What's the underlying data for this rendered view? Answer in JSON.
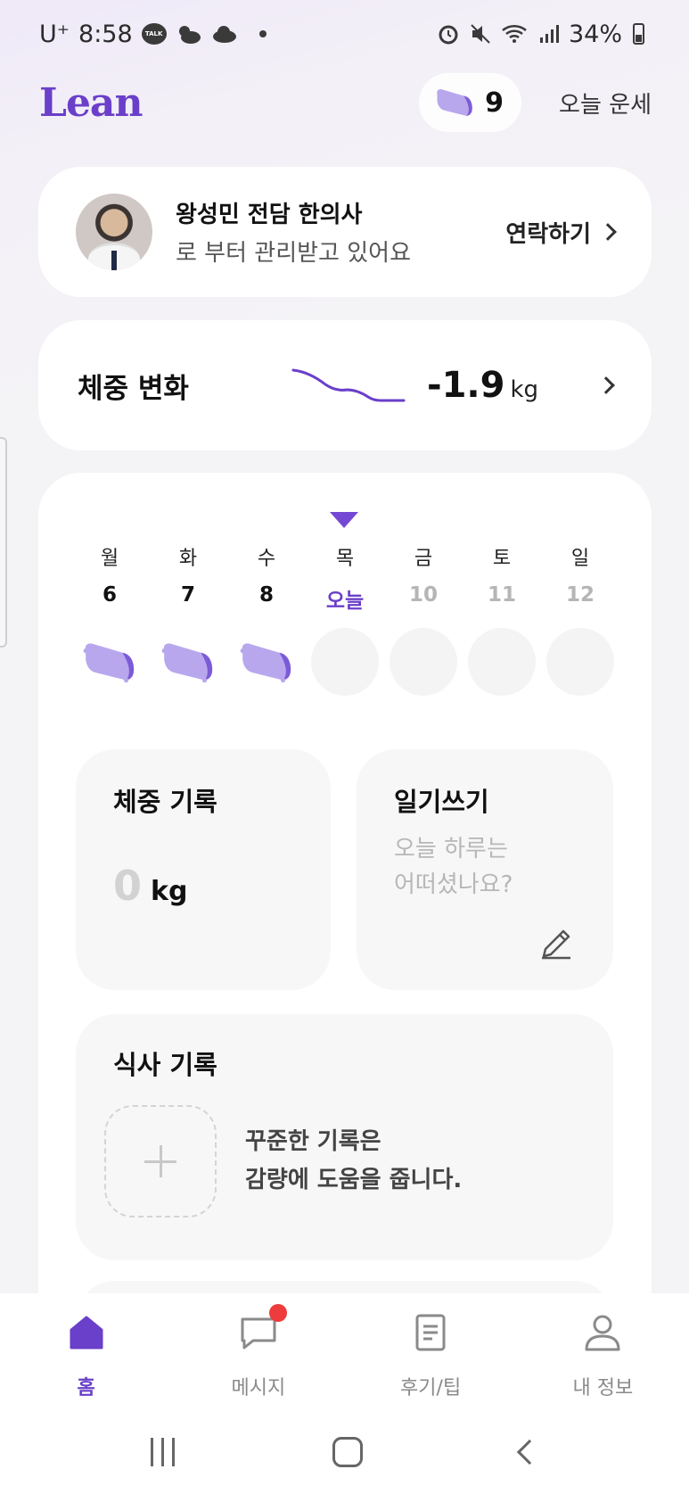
{
  "status_bar": {
    "carrier": "U⁺",
    "time": "8:58",
    "battery": "34%"
  },
  "header": {
    "logo": "Lean",
    "pillow_count": "9",
    "fortune_label": "오늘 운세"
  },
  "doctor": {
    "name": "왕성민 전담 한의사",
    "subtitle": "로 부터 관리받고 있어요",
    "contact_label": "연락하기"
  },
  "weight_change": {
    "title": "체중 변화",
    "value": "-1.9",
    "unit": "kg"
  },
  "week": {
    "days": [
      {
        "name": "월",
        "date": "6",
        "state": "done"
      },
      {
        "name": "화",
        "date": "7",
        "state": "done"
      },
      {
        "name": "수",
        "date": "8",
        "state": "done"
      },
      {
        "name": "목",
        "date": "오늘",
        "state": "today"
      },
      {
        "name": "금",
        "date": "10",
        "state": "future"
      },
      {
        "name": "토",
        "date": "11",
        "state": "future"
      },
      {
        "name": "일",
        "date": "12",
        "state": "future"
      }
    ]
  },
  "weight_record": {
    "title": "체중 기록",
    "value": "0",
    "unit": "kg"
  },
  "diary": {
    "title": "일기쓰기",
    "placeholder_line1": "오늘 하루는",
    "placeholder_line2": "어떠셨나요?"
  },
  "meal": {
    "title": "식사 기록",
    "message_line1": "꾸준한 기록은",
    "message_line2": "감량에 도움을 줍니다."
  },
  "tabs": [
    {
      "label": "홈",
      "icon": "home-icon",
      "active": true
    },
    {
      "label": "메시지",
      "icon": "message-icon",
      "active": false
    },
    {
      "label": "후기/팁",
      "icon": "document-icon",
      "active": false
    },
    {
      "label": "내 정보",
      "icon": "person-icon",
      "active": false
    }
  ],
  "colors": {
    "accent": "#6a3fc9",
    "pillow": "#b9a7ee",
    "notification": "#ee3b3b"
  }
}
